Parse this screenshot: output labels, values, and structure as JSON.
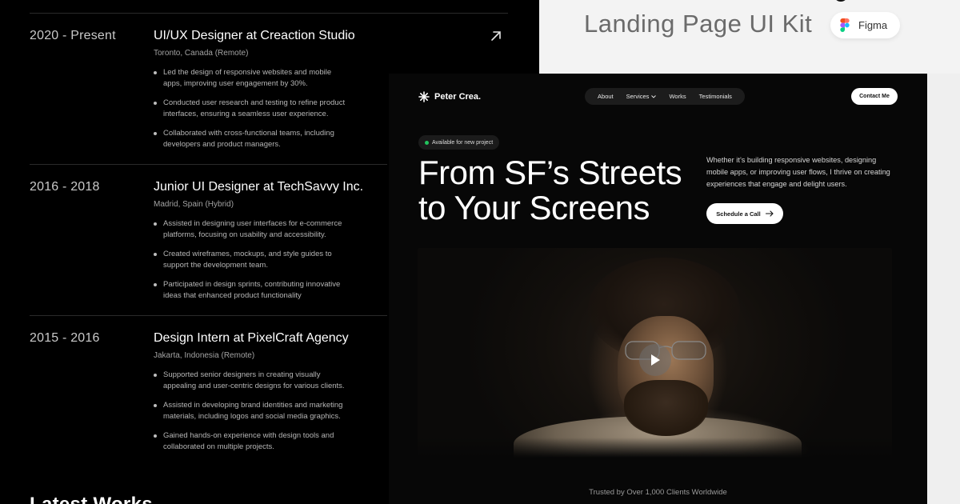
{
  "experience": [
    {
      "period": "2020 - Present",
      "title": "UI/UX Designer at Creaction Studio",
      "location": "Toronto, Canada (Remote)",
      "bullets": [
        "Led the design of responsive websites and mobile apps, improving user engagement by 30%.",
        "Conducted user research and testing to refine product interfaces, ensuring a seamless user experience.",
        "Collaborated with cross-functional teams, including developers and product managers."
      ]
    },
    {
      "period": "2016 - 2018",
      "title": "Junior UI Designer at TechSavvy Inc.",
      "location": "Madrid, Spain (Hybrid)",
      "bullets": [
        "Assisted in designing user interfaces for e-commerce platforms, focusing on usability and accessibility.",
        "Created wireframes, mockups, and style guides to support the development team.",
        "Participated in design sprints, contributing innovative ideas that enhanced product functionality"
      ]
    },
    {
      "period": "2015 - 2016",
      "title": "Design Intern at PixelCraft Agency",
      "location": "Jakarta, Indonesia (Remote)",
      "bullets": [
        "Supported senior designers in creating visually appealing and user-centric designs for various clients.",
        "Assisted in developing brand identities and marketing materials, including logos and social media graphics.",
        "Gained hands-on experience with design tools and collaborated on multiple projects."
      ]
    }
  ],
  "bottom_heading": "Latest Works",
  "kit": {
    "title": "Landing Page UI Kit",
    "figma_label": "Figma"
  },
  "landing": {
    "brand": "Peter Crea.",
    "nav": {
      "about": "About",
      "services": "Services",
      "works": "Works",
      "testimonials": "Testimonials"
    },
    "contact": "Contact Me",
    "badge": "Available for new project",
    "hero_line1": "From SF’s Streets",
    "hero_line2": "to Your Screens",
    "description": "Whether it’s building responsive websites, designing mobile apps, or improving user flows, I thrive on creating experiences that engage and delight users.",
    "schedule": "Schedule a Call",
    "trusted": "Trusted by Over 1,000 Clients Worldwide"
  },
  "colors": {
    "available_dot": "#22c55e",
    "background": "#000000",
    "banner": "#f3f3f3"
  },
  "icons": [
    "arrow-up-right-icon",
    "figma-icon",
    "sparkle-logo-icon",
    "chevron-down-icon",
    "arrow-right-icon",
    "play-icon"
  ]
}
